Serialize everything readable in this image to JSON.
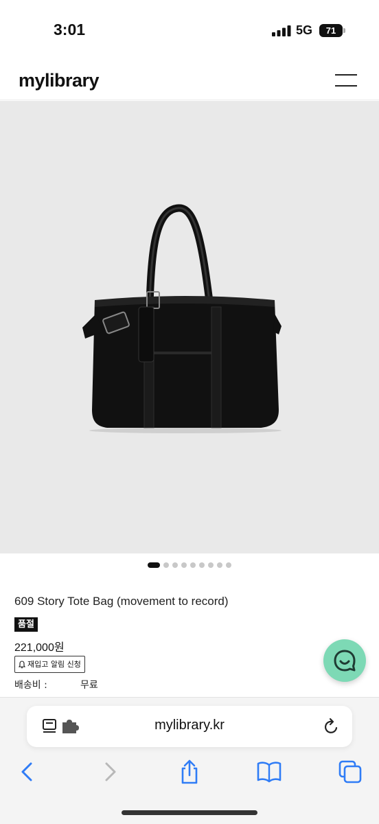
{
  "status_bar": {
    "time": "3:01",
    "network": "5G",
    "battery": "71"
  },
  "header": {
    "logo": "mylibrary",
    "menu_icon": "hamburger-icon"
  },
  "product": {
    "image_alt_icon": "tote-bag-image",
    "carousel": {
      "total": 9,
      "active": 1
    },
    "name": "609 Story Tote Bag (movement to record)",
    "badge": "품절",
    "price": "221,000원",
    "restock_button": "재입고 알림 신청",
    "shipping_label": "배송비 :",
    "shipping_value": "무료"
  },
  "chat": {
    "icon": "chat-smile-icon"
  },
  "browser": {
    "url": "mylibrary.kr",
    "icons": [
      "reader-mode-icon",
      "extension-icon",
      "reload-icon",
      "back-icon",
      "forward-icon",
      "share-icon",
      "bookmarks-icon",
      "tabs-icon"
    ]
  },
  "colors": {
    "chat_button": "#7dd9b5",
    "browser_blue": "#2f7cf6",
    "image_background": "#e9e9e9"
  }
}
